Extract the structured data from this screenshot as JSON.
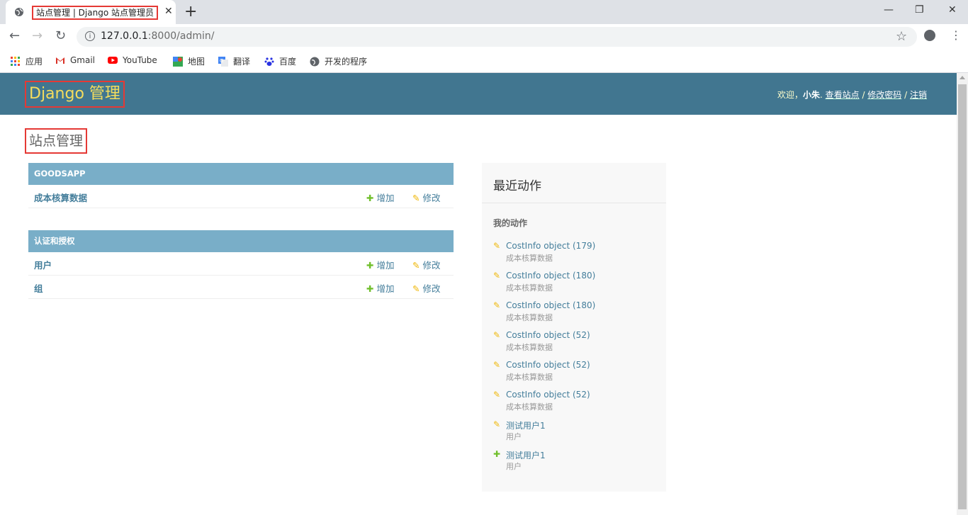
{
  "browser": {
    "tab_title": "站点管理 | Django 站点管理员",
    "tab_close": "✕",
    "new_tab": "+",
    "url_host": "127.0.0.1",
    "url_rest": ":8000/admin/",
    "bookmarks": [
      "应用",
      "Gmail",
      "YouTube",
      "地图",
      "翻译",
      "百度",
      "开发的程序"
    ]
  },
  "header": {
    "brand": "Django 管理",
    "welcome": "欢迎，",
    "username": "小朱",
    "sep": ". ",
    "view_site": "查看站点",
    "change_password": "修改密码",
    "logout": "注销",
    "slash": " / "
  },
  "content": {
    "title": "站点管理"
  },
  "modules": [
    {
      "caption": "GOODSAPP",
      "rows": [
        {
          "name": "成本核算数据",
          "add": "增加",
          "change": "修改"
        }
      ]
    },
    {
      "caption": "认证和授权",
      "rows": [
        {
          "name": "用户",
          "add": "增加",
          "change": "修改"
        },
        {
          "name": "组",
          "add": "增加",
          "change": "修改"
        }
      ]
    }
  ],
  "recent": {
    "title": "最近动作",
    "subtitle": "我的动作",
    "actions": [
      {
        "kind": "change",
        "link": "CostInfo object (179)",
        "type": "成本核算数据"
      },
      {
        "kind": "change",
        "link": "CostInfo object (180)",
        "type": "成本核算数据"
      },
      {
        "kind": "change",
        "link": "CostInfo object (180)",
        "type": "成本核算数据"
      },
      {
        "kind": "change",
        "link": "CostInfo object (52)",
        "type": "成本核算数据"
      },
      {
        "kind": "change",
        "link": "CostInfo object (52)",
        "type": "成本核算数据"
      },
      {
        "kind": "change",
        "link": "CostInfo object (52)",
        "type": "成本核算数据"
      },
      {
        "kind": "change",
        "link": "测试用户1",
        "type": "用户"
      },
      {
        "kind": "add",
        "link": "测试用户1",
        "type": "用户"
      }
    ]
  },
  "icons": {
    "add": "✚",
    "change": "✎"
  },
  "colors": {
    "header_bg": "#417690",
    "brand": "#f5dd5d",
    "caption_bg": "#79aec8",
    "link": "#447e9b",
    "add_icon": "#70bf2b",
    "change_icon": "#efb80b"
  }
}
